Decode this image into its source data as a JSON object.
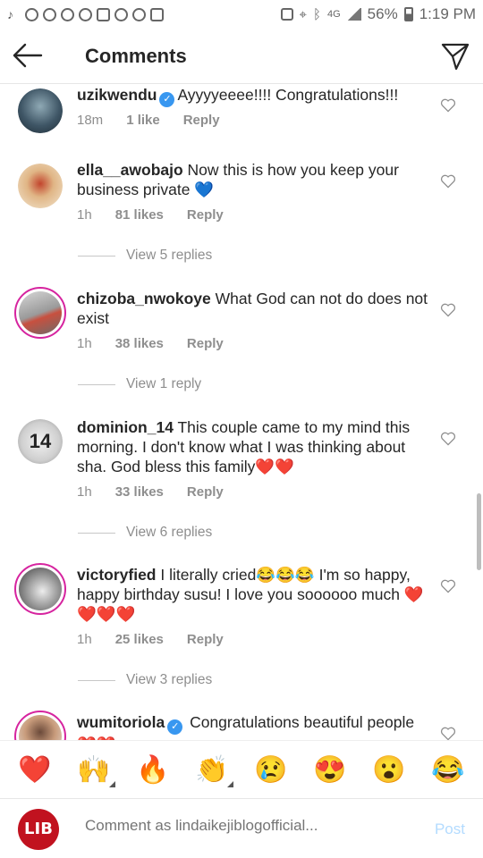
{
  "statusbar": {
    "battery": "56%",
    "time": "1:19 PM"
  },
  "header": {
    "title": "Comments"
  },
  "comments": [
    {
      "user": "uzikwendu",
      "verified": true,
      "text": "Ayyyyeeee!!!! Congratulations!!!",
      "time": "18m",
      "likes": "1 like",
      "reply": "Reply",
      "view_replies": ""
    },
    {
      "user": "ella__awobajo",
      "verified": false,
      "text": "Now this is how you keep your business private 💙",
      "time": "1h",
      "likes": "81 likes",
      "reply": "Reply",
      "view_replies": "View 5 replies"
    },
    {
      "user": "chizoba_nwokoye",
      "verified": false,
      "text": "What God can not do does not exist",
      "time": "1h",
      "likes": "38 likes",
      "reply": "Reply",
      "view_replies": "View 1 reply"
    },
    {
      "user": "dominion_14",
      "verified": false,
      "text": "This couple came to my mind this morning. I don't know what I was thinking about sha. God bless this family❤️❤️",
      "time": "1h",
      "likes": "33 likes",
      "reply": "Reply",
      "view_replies": "View 6 replies"
    },
    {
      "user": "victoryfied",
      "verified": false,
      "text": "I literally cried😂😂😂 I'm so happy, happy birthday susu! I love you soooooo much ❤️❤️❤️❤️",
      "time": "1h",
      "likes": "25 likes",
      "reply": "Reply",
      "view_replies": "View 3 replies"
    },
    {
      "user": "wumitoriola",
      "verified": true,
      "text": "Congratulations beautiful people❤️❤️",
      "time": "",
      "likes": "",
      "reply": "",
      "view_replies": ""
    }
  ],
  "emojis": [
    "❤️",
    "🙌",
    "🔥",
    "👏",
    "😢",
    "😍",
    "😮",
    "😂"
  ],
  "input": {
    "avatar_text": "LIB",
    "placeholder": "Comment as lindaikejiblogofficial...",
    "post_label": "Post"
  },
  "colors": {
    "accent": "#3897f0",
    "post_disabled": "#b3dbff",
    "heart": "#ed4956",
    "ring": "#d6249f"
  }
}
